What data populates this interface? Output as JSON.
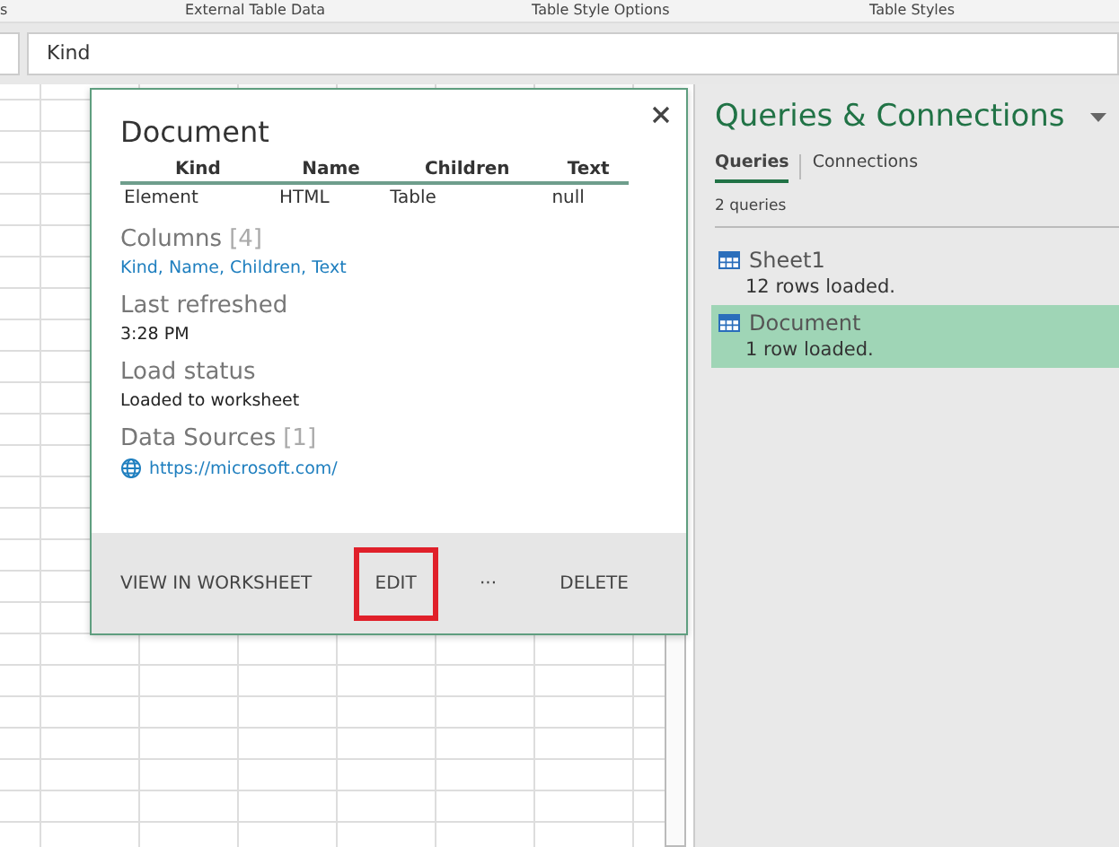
{
  "ribbon": {
    "groups": [
      "s",
      "External Table Data",
      "Table Style Options",
      "Table Styles"
    ]
  },
  "formula_bar": {
    "value": "Kind"
  },
  "popup": {
    "title": "Document",
    "preview": {
      "columns": [
        "Kind",
        "Name",
        "Children",
        "Text"
      ],
      "rows": [
        [
          "Element",
          "HTML",
          "Table",
          "null"
        ]
      ]
    },
    "sections": [
      {
        "label": "Columns",
        "count": "[4]",
        "value": "Kind, Name, Children, Text",
        "kind": "columns"
      },
      {
        "label": "Last refreshed",
        "value": "3:28 PM",
        "kind": "text"
      },
      {
        "label": "Load status",
        "value": "Loaded to worksheet",
        "kind": "text"
      },
      {
        "label": "Data Sources",
        "count": "[1]",
        "value": "https://microsoft.com/",
        "kind": "link"
      }
    ],
    "actions": [
      {
        "label": "VIEW IN WORKSHEET",
        "highlighted": false
      },
      {
        "label": "EDIT",
        "highlighted": true
      },
      {
        "label": "···",
        "highlighted": false
      },
      {
        "label": "DELETE",
        "highlighted": false
      }
    ]
  },
  "pane": {
    "title": "Queries & Connections",
    "tabs": [
      {
        "label": "Queries",
        "selected": true
      },
      {
        "label": "Connections",
        "selected": false
      }
    ],
    "count": "2 queries",
    "queries": [
      {
        "name": "Sheet1",
        "status": "12 rows loaded.",
        "selected": false
      },
      {
        "name": "Document",
        "status": "1 row loaded.",
        "selected": true
      }
    ]
  }
}
